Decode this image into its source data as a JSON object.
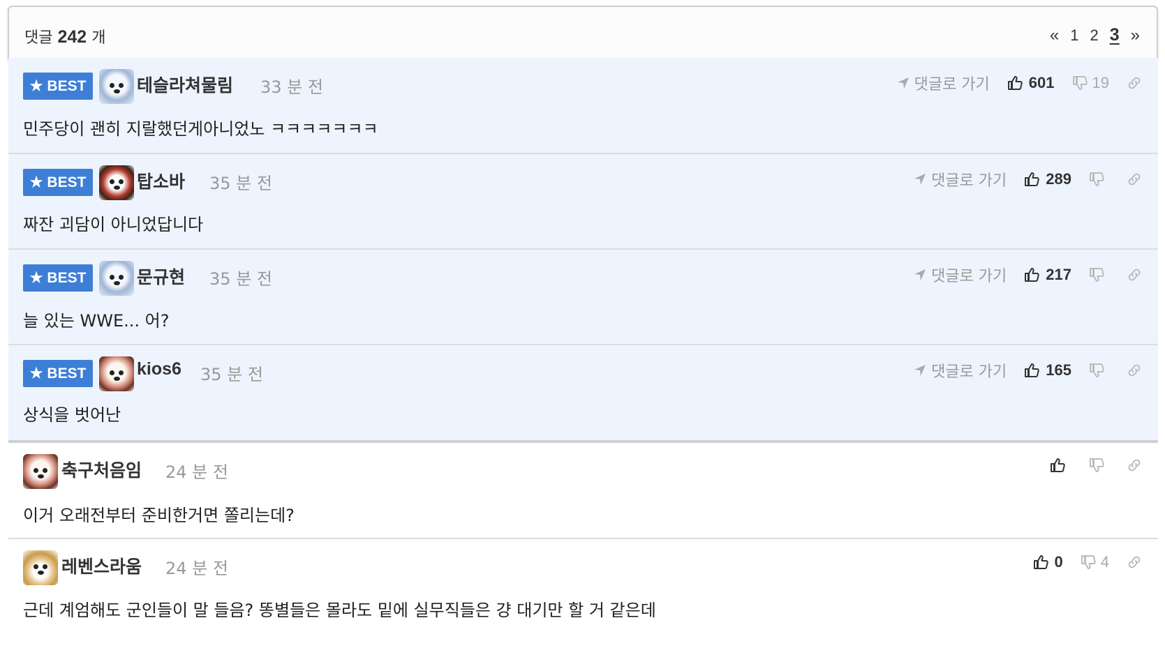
{
  "header": {
    "count_prefix": "댓글",
    "count_value": "242",
    "count_suffix": "개",
    "pager": {
      "prev": "«",
      "pages": [
        "1",
        "2",
        "3"
      ],
      "current": "3",
      "next": "»"
    }
  },
  "best_label": "BEST",
  "goto_label": "댓글로 가기",
  "comments": [
    {
      "best": true,
      "user": "테슬라쳐물림",
      "time": "33 분 전",
      "text": "민주당이 괜히 지랄했던게아니었노 ㅋㅋㅋㅋㅋㅋㅋ",
      "likes": "601",
      "dislikes": "19",
      "avatar": "bluebear"
    },
    {
      "best": true,
      "user": "탑소바",
      "time": "35 분 전",
      "text": "짜잔 괴담이 아니었답니다",
      "likes": "289",
      "dislikes": "",
      "avatar": "redbear"
    },
    {
      "best": true,
      "user": "문규현",
      "time": "35 분 전",
      "text": "늘 있는 WWE... 어?",
      "likes": "217",
      "dislikes": "",
      "avatar": "bluebear"
    },
    {
      "best": true,
      "user": "kios6",
      "time": "35 분 전",
      "text": "상식을 벗어난",
      "likes": "165",
      "dislikes": "",
      "avatar": "pug"
    },
    {
      "best": false,
      "user": "축구처음임",
      "time": "24 분 전",
      "text": "이거 오래전부터 준비한거면 쫄리는데?",
      "likes": "",
      "dislikes": "",
      "avatar": "pug"
    },
    {
      "best": false,
      "user": "레벤스라움",
      "time": "24 분 전",
      "text": "근데 계엄해도 군인들이 말 들음? 똥별들은 몰라도 밑에 실무직들은 걍 대기만 할 거 같은데",
      "likes": "0",
      "dislikes": "4",
      "avatar": "fox"
    }
  ],
  "icons": {
    "best": "star-icon",
    "goto": "send-arrow-icon",
    "like": "thumbs-up-icon",
    "dislike": "thumbs-down-icon",
    "permalink": "link-icon"
  },
  "colors": {
    "best_badge": "#3d7fd6",
    "best_row_bg": "#eef4fd"
  }
}
